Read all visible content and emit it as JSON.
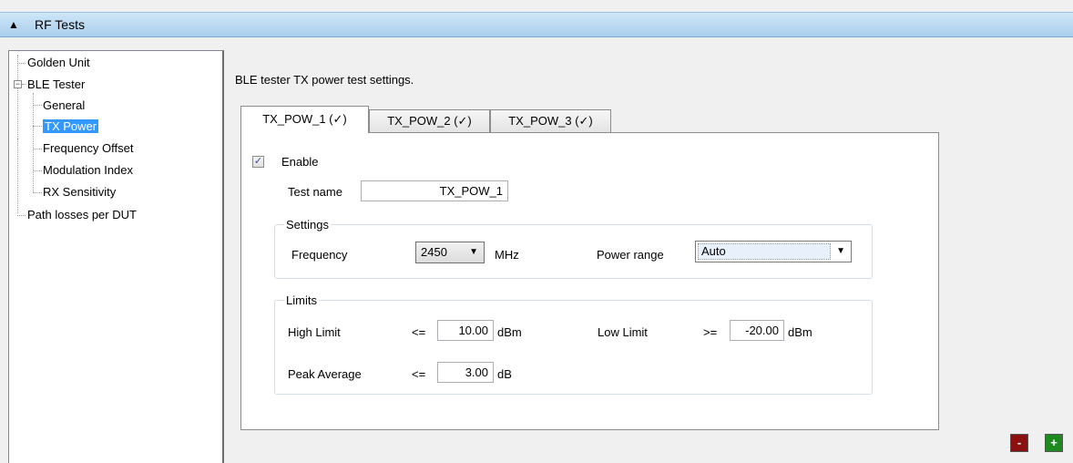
{
  "header": {
    "title": "RF Tests",
    "collapse_icon": "triangle-up-icon"
  },
  "tree": {
    "items": [
      {
        "label": "Golden Unit"
      },
      {
        "label": "BLE Tester"
      },
      {
        "label": "General"
      },
      {
        "label": "TX Power"
      },
      {
        "label": "Frequency Offset"
      },
      {
        "label": "Modulation Index"
      },
      {
        "label": "RX Sensitivity"
      },
      {
        "label": "Path losses per DUT"
      }
    ],
    "selected": "TX Power",
    "expander": "−"
  },
  "main": {
    "description": "BLE tester TX power test settings.",
    "tabs": [
      {
        "label": "TX_POW_1 (✓)"
      },
      {
        "label": "TX_POW_2 (✓)"
      },
      {
        "label": "TX_POW_3 (✓)"
      }
    ],
    "active_tab": "TX_POW_1 (✓)",
    "enable": {
      "label": "Enable",
      "checked": true,
      "check_glyph": "✓"
    },
    "test_name": {
      "label": "Test name",
      "value": "TX_POW_1"
    },
    "settings": {
      "title": "Settings",
      "frequency_label": "Frequency",
      "frequency_value": "2450",
      "frequency_unit": "MHz",
      "power_range_label": "Power range",
      "power_range_value": "Auto"
    },
    "limits": {
      "title": "Limits",
      "high_limit_label": "High Limit",
      "high_limit_op": "<=",
      "high_limit_value": "10.00",
      "high_limit_unit": "dBm",
      "low_limit_label": "Low Limit",
      "low_limit_op": ">=",
      "low_limit_value": "-20.00",
      "low_limit_unit": "dBm",
      "peak_average_label": "Peak Average",
      "peak_average_op": "<=",
      "peak_average_value": "3.00",
      "peak_average_unit": "dB"
    }
  },
  "buttons": {
    "remove_label": "-",
    "add_label": "+"
  },
  "colors": {
    "header": "#b9daf2",
    "selection": "#3399ff",
    "remove": "#8b1010",
    "add": "#1f8a1f"
  }
}
